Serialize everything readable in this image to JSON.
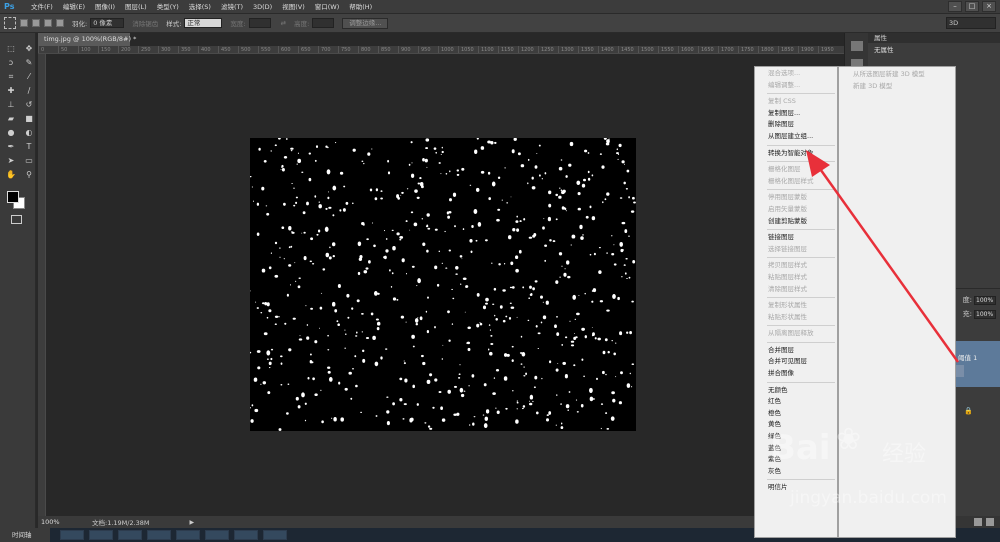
{
  "app": {
    "logo": "Ps"
  },
  "menubar": {
    "items": [
      "文件(F)",
      "编辑(E)",
      "图像(I)",
      "图层(L)",
      "类型(Y)",
      "选择(S)",
      "滤镜(T)",
      "3D(D)",
      "视图(V)",
      "窗口(W)",
      "帮助(H)"
    ],
    "window_controls": [
      "–",
      "□",
      "×"
    ]
  },
  "options": {
    "feather_label": "羽化:",
    "feather_value": "0 像素",
    "antialias_label": "消除锯齿",
    "style_label": "样式:",
    "style_value": "正常",
    "width_label": "宽度:",
    "height_label": "高度:",
    "refine_edge": "调整边缘...",
    "workspace": "3D"
  },
  "document": {
    "tab": "timg.jpg @ 100%(RGB/8#) *",
    "zoom": "100%",
    "doc_info": "文档:1.19M/2.38M",
    "ruler_ticks": [
      "0",
      "50",
      "100",
      "150",
      "200",
      "250",
      "300",
      "350",
      "400",
      "450",
      "500",
      "550",
      "600",
      "650",
      "700",
      "750",
      "800",
      "850",
      "900",
      "950",
      "1000",
      "1050",
      "1100",
      "1150",
      "1200",
      "1250",
      "1300",
      "1350",
      "1400",
      "1450",
      "1500",
      "1550",
      "1600",
      "1650",
      "1700",
      "1750",
      "1800",
      "1850",
      "1900",
      "1950"
    ]
  },
  "timeline": "时间轴",
  "properties": {
    "header": "属性",
    "title": "无属性"
  },
  "layers": {
    "opacity_label": "度:",
    "opacity": "100%",
    "fill_label": "充:",
    "fill": "100%",
    "layer_name": "阈值 1"
  },
  "context_menu": {
    "items": [
      {
        "label": "混合选项...",
        "disabled": true
      },
      {
        "label": "编辑调整...",
        "disabled": true
      },
      {
        "sep": true
      },
      {
        "label": "复制 CSS",
        "disabled": true
      },
      {
        "label": "复制图层...",
        "disabled": false
      },
      {
        "label": "删除图层",
        "disabled": false
      },
      {
        "label": "从图层建立组...",
        "disabled": false
      },
      {
        "sep": true
      },
      {
        "label": "转换为智能对象",
        "disabled": false
      },
      {
        "sep": true
      },
      {
        "label": "栅格化图层",
        "disabled": true
      },
      {
        "label": "栅格化图层样式",
        "disabled": true
      },
      {
        "sep": true
      },
      {
        "label": "停用图层蒙版",
        "disabled": true
      },
      {
        "label": "启用矢量蒙版",
        "disabled": true
      },
      {
        "label": "创建剪贴蒙版",
        "disabled": false
      },
      {
        "sep": true
      },
      {
        "label": "链接图层",
        "disabled": false
      },
      {
        "label": "选择链接图层",
        "disabled": true
      },
      {
        "sep": true
      },
      {
        "label": "拷贝图层样式",
        "disabled": true
      },
      {
        "label": "粘贴图层样式",
        "disabled": true
      },
      {
        "label": "清除图层样式",
        "disabled": true
      },
      {
        "sep": true
      },
      {
        "label": "复制形状属性",
        "disabled": true
      },
      {
        "label": "粘贴形状属性",
        "disabled": true
      },
      {
        "sep": true
      },
      {
        "label": "从隔离图层释放",
        "disabled": true
      },
      {
        "sep": true
      },
      {
        "label": "合并图层",
        "disabled": false
      },
      {
        "label": "合并可见图层",
        "disabled": false
      },
      {
        "label": "拼合图像",
        "disabled": false
      },
      {
        "sep": true
      },
      {
        "label": "无颜色",
        "disabled": false
      },
      {
        "label": "红色",
        "disabled": false
      },
      {
        "label": "橙色",
        "disabled": false
      },
      {
        "label": "黄色",
        "disabled": false
      },
      {
        "label": "绿色",
        "disabled": false
      },
      {
        "label": "蓝色",
        "disabled": false
      },
      {
        "label": "紫色",
        "disabled": false
      },
      {
        "label": "灰色",
        "disabled": false
      },
      {
        "sep": true
      },
      {
        "label": "明信片",
        "disabled": false
      }
    ]
  },
  "submenu": {
    "items": [
      "从所选图层新建 3D 模型",
      "新建 3D 模型"
    ]
  },
  "watermark": {
    "logo": "Bai",
    "cn": "经验",
    "url": "jingyan.baidu.com"
  },
  "colors": {
    "accent": "#3ca1e6",
    "arrow": "#e8303a",
    "canvas": "#000000",
    "selected_layer": "#5d7a9a"
  }
}
